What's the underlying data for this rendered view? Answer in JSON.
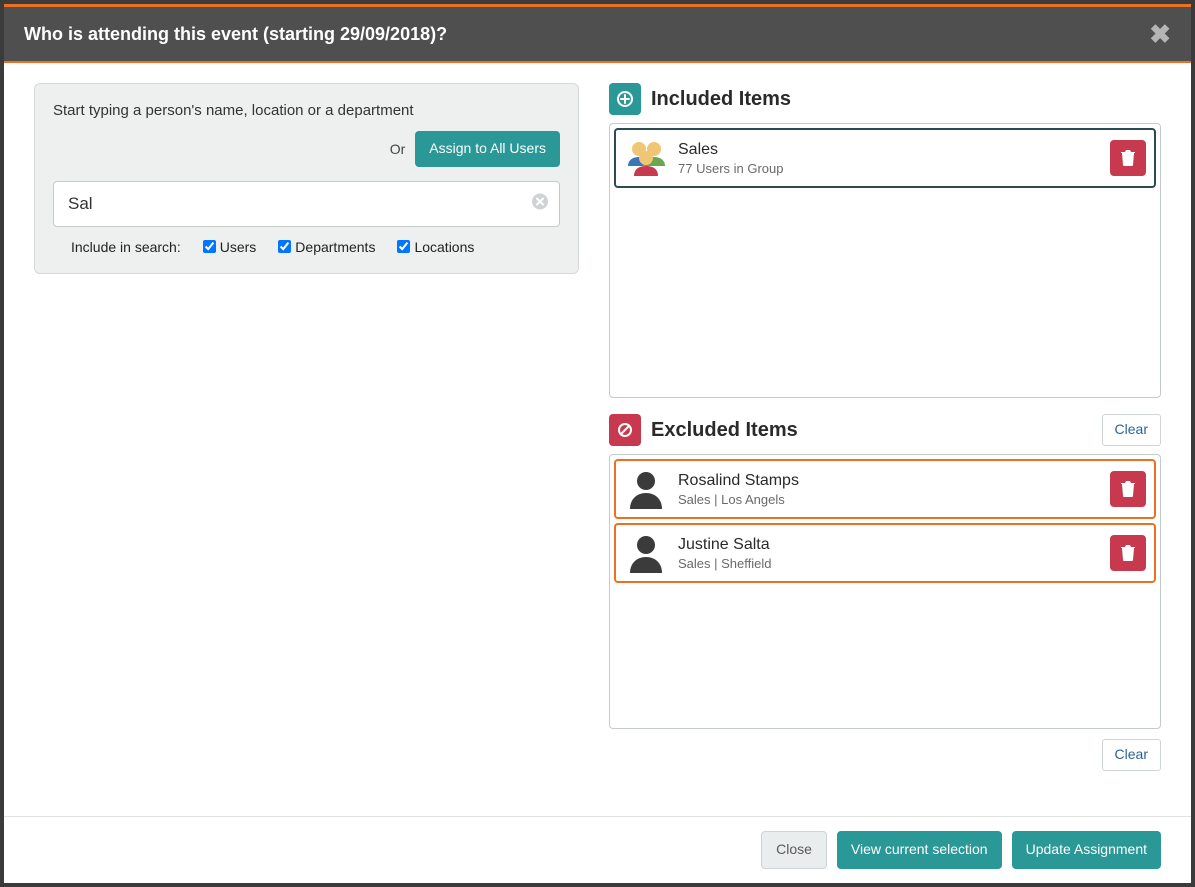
{
  "modal": {
    "title": "Who is attending this event (starting 29/09/2018)?",
    "close_aria": "Close"
  },
  "search": {
    "hint": "Start typing a person's name, location or a department",
    "or_label": "Or",
    "assign_all_label": "Assign to All Users",
    "value": "Sal",
    "include_label": "Include in search:",
    "filters": {
      "users": {
        "label": "Users",
        "checked": true
      },
      "departments": {
        "label": "Departments",
        "checked": true
      },
      "locations": {
        "label": "Locations",
        "checked": true
      }
    }
  },
  "included": {
    "title": "Included Items",
    "items": [
      {
        "name": "Sales",
        "sub": "77 Users in Group",
        "type": "group"
      }
    ]
  },
  "excluded": {
    "title": "Excluded Items",
    "clear_label": "Clear",
    "items": [
      {
        "name": "Rosalind Stamps",
        "sub": "Sales | Los Angels",
        "type": "user"
      },
      {
        "name": "Justine Salta",
        "sub": "Sales | Sheffield",
        "type": "user"
      }
    ]
  },
  "footer": {
    "clear_label": "Clear",
    "close_label": "Close",
    "view_label": "View current selection",
    "update_label": "Update Assignment"
  }
}
